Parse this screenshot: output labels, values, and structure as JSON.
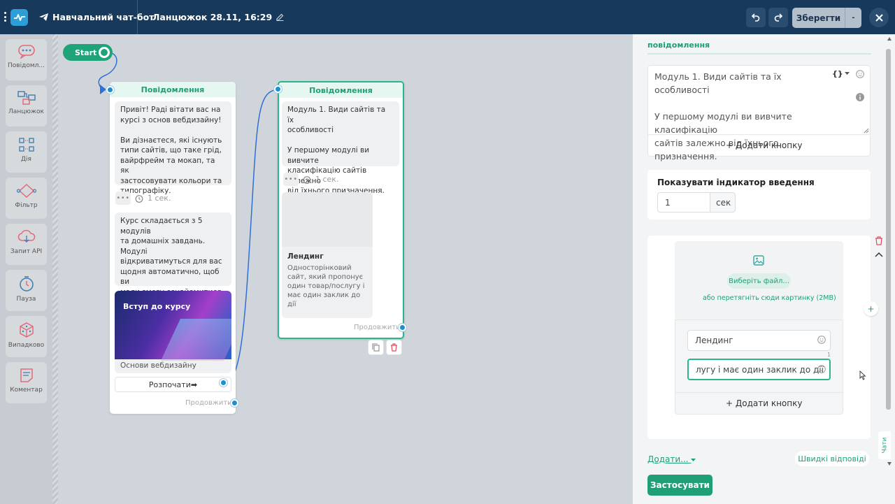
{
  "topbar": {
    "bot_name": "Навчальний чат-бот",
    "chain_name": "Ланцюжок 28.11, 16:29",
    "save_label": "Зберегти",
    "save_dropdown": "-"
  },
  "sidebar": {
    "items": [
      {
        "label": "Повідомл...",
        "icon": "chat-bubble-icon"
      },
      {
        "label": "Ланцюжок",
        "icon": "chain-icon"
      },
      {
        "label": "Дія",
        "icon": "action-icon"
      },
      {
        "label": "Фільтр",
        "icon": "filter-icon"
      },
      {
        "label": "Запит API",
        "icon": "cloud-api-icon"
      },
      {
        "label": "Пауза",
        "icon": "timer-icon"
      },
      {
        "label": "Випадково",
        "icon": "dice-icon"
      },
      {
        "label": "Коментар",
        "icon": "note-icon"
      }
    ]
  },
  "canvas": {
    "start_label": "Start",
    "node1": {
      "header": "Повідомлення",
      "bubble1": "Привіт! Раді вітати вас на\nкурсі з основ вебдизайну!\n\nВи дізнаєтеся, які існують\nтипи сайтів, що таке грід,\nвайрфрейм та мокап, та як\nзастосовувати кольори та\nтипографіку.",
      "delay": "1 сек.",
      "bubble2": "Курс складається з 5 модулів\nта домашніх завдань. Модулі\nвідкриватимуться для вас\nщодня автоматично, щоб ви\nмали змогу ознайомитися з\nматеріалами та виконати\nдомашні завдання.",
      "card_image_title": "Вступ до курсу",
      "card_caption": "Основи вебдизайну",
      "button_label": "Розпочати➡",
      "continue_label": "Продовжити"
    },
    "node2": {
      "header": "Повідомлення",
      "bubble1": "Модуль 1. Види сайтів та їх\nособливості\n\nУ першому модулі ви вивчите\nкласифікацію сайтів залежно\nвід їхнього призначення.",
      "delay": "1 сек.",
      "card_title": "Лендинг",
      "card_desc": "Односторінковий\nсайт, який пропонує\nодин товар/послугу і\nмає один заклик до\nдії",
      "continue_label": "Продовжити"
    }
  },
  "panel": {
    "section_title": "повідомлення",
    "message_text": "Модуль 1. Види сайтів та їх особливості\n\nУ першому модулі ви вивчите класифікацію\nсайтів залежно від їхнього призначення.",
    "vars_label": "{}",
    "add_button_label": "+ Додати кнопку",
    "typing_indicator_label": "Показувати індикатор введення",
    "typing_value": "1",
    "typing_unit": "сек",
    "choose_file_label": "Виберіть файл...",
    "drag_hint": "або перетягніть сюди картинку (2MB)",
    "card_title_value": "Лендинг",
    "card_desc_value": "лугу і має один заклик до дії",
    "char_counter": "1",
    "add_button_label_2": "+ Додати кнопку",
    "add_more_label": "Додати...",
    "quick_replies_label": "Швидкі відповіді",
    "apply_label": "Застосувати",
    "chat_tab_label": "Чати"
  },
  "colors": {
    "topbar": "#173a5c",
    "accent_green": "#1f9e78",
    "port_blue": "#1b8fcf"
  }
}
